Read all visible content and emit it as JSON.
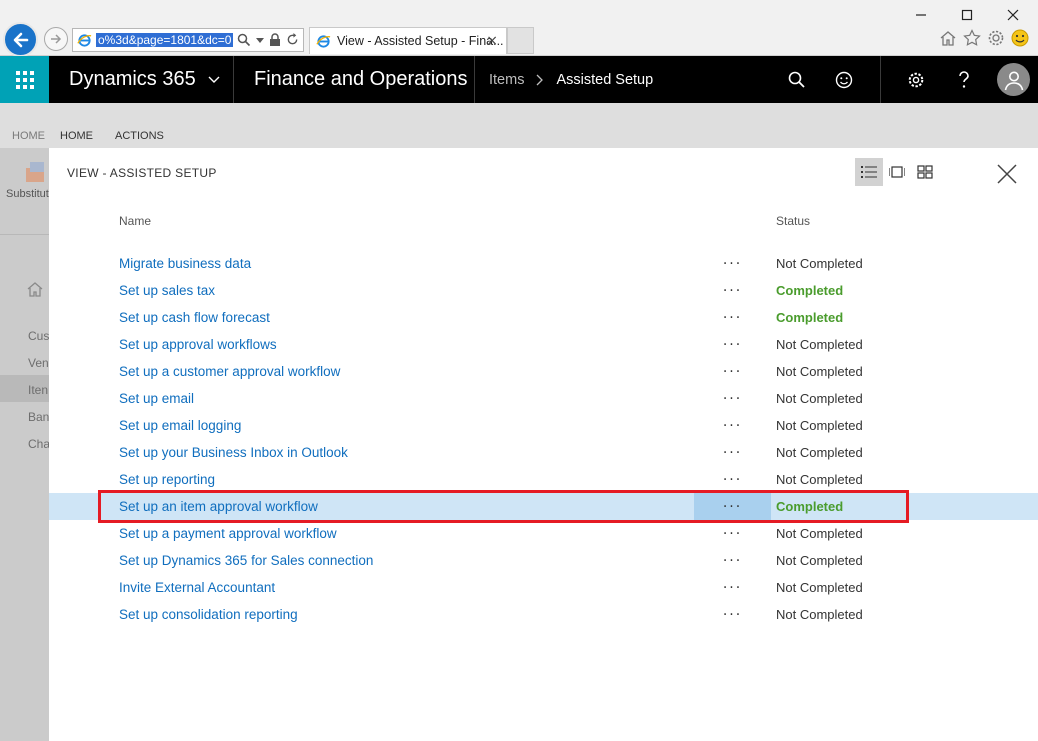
{
  "browser": {
    "address_text": "o%3d&page=1801&dc=0",
    "tab_title": "View - Assisted Setup - Fina...",
    "tab_close": "×",
    "win_minimize": "—",
    "win_close": "✕"
  },
  "header": {
    "brand": "Dynamics 365",
    "app_title": "Finance and Operations",
    "breadcrumb": [
      "Items",
      "Assisted Setup"
    ]
  },
  "background": {
    "ribbon_tabs": [
      "HOME",
      "HOME",
      "ACTIONS"
    ],
    "ribbon_button_label": "Substitut",
    "left_items": [
      "Cus",
      "Ven",
      "Iten",
      "Ban",
      "Cha"
    ]
  },
  "dialog": {
    "title": "VIEW - ASSISTED SETUP",
    "columns": {
      "name": "Name",
      "status": "Status"
    },
    "more_label": "···",
    "rows": [
      {
        "name": "Migrate business data",
        "status": "Not Completed"
      },
      {
        "name": "Set up sales tax",
        "status": "Completed"
      },
      {
        "name": "Set up cash flow forecast",
        "status": "Completed"
      },
      {
        "name": "Set up approval workflows",
        "status": "Not Completed"
      },
      {
        "name": "Set up a customer approval workflow",
        "status": "Not Completed"
      },
      {
        "name": "Set up email",
        "status": "Not Completed"
      },
      {
        "name": "Set up email logging",
        "status": "Not Completed"
      },
      {
        "name": "Set up your Business Inbox in Outlook",
        "status": "Not Completed"
      },
      {
        "name": "Set up reporting",
        "status": "Not Completed"
      },
      {
        "name": "Set up an item approval workflow",
        "status": "Completed",
        "selected": true
      },
      {
        "name": "Set up a payment approval workflow",
        "status": "Not Completed"
      },
      {
        "name": "Set up Dynamics 365 for Sales connection",
        "status": "Not Completed"
      },
      {
        "name": "Invite External Accountant",
        "status": "Not Completed"
      },
      {
        "name": "Set up consolidation reporting",
        "status": "Not Completed"
      }
    ]
  },
  "colors": {
    "accent": "#00a2b6",
    "appbar": "#000000",
    "link": "#106ebe",
    "completed": "#4a9c2d",
    "selected_row": "#cfe5f6",
    "annotation": "#e51b24"
  }
}
